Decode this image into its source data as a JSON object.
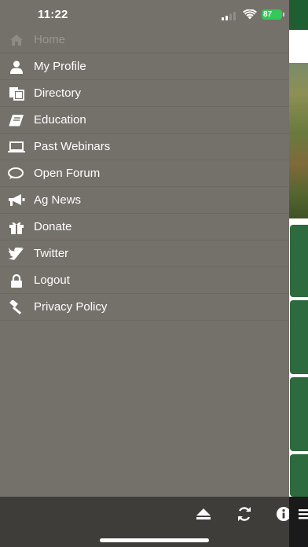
{
  "status_bar": {
    "time": "11:22",
    "battery": "87"
  },
  "menu": {
    "items": [
      {
        "label": "Home",
        "icon": "home-icon",
        "active": true
      },
      {
        "label": "My Profile",
        "icon": "user-icon"
      },
      {
        "label": "Directory",
        "icon": "copy-icon"
      },
      {
        "label": "Education",
        "icon": "book-icon"
      },
      {
        "label": "Past Webinars",
        "icon": "laptop-icon"
      },
      {
        "label": "Open Forum",
        "icon": "chat-icon"
      },
      {
        "label": "Ag News",
        "icon": "megaphone-icon"
      },
      {
        "label": "Donate",
        "icon": "gift-icon"
      },
      {
        "label": "Twitter",
        "icon": "twitter-icon"
      },
      {
        "label": "Logout",
        "icon": "lock-icon"
      },
      {
        "label": "Privacy Policy",
        "icon": "gavel-icon"
      }
    ]
  },
  "toolbar": {
    "icons": [
      "eject-icon",
      "refresh-icon",
      "info-icon",
      "menu-icon"
    ]
  },
  "colors": {
    "drawer_bg": "#74706a",
    "active_text": "#9a968f",
    "brand_green": "#2d6a3e",
    "toolbar_bg": "#3f3d3a"
  }
}
